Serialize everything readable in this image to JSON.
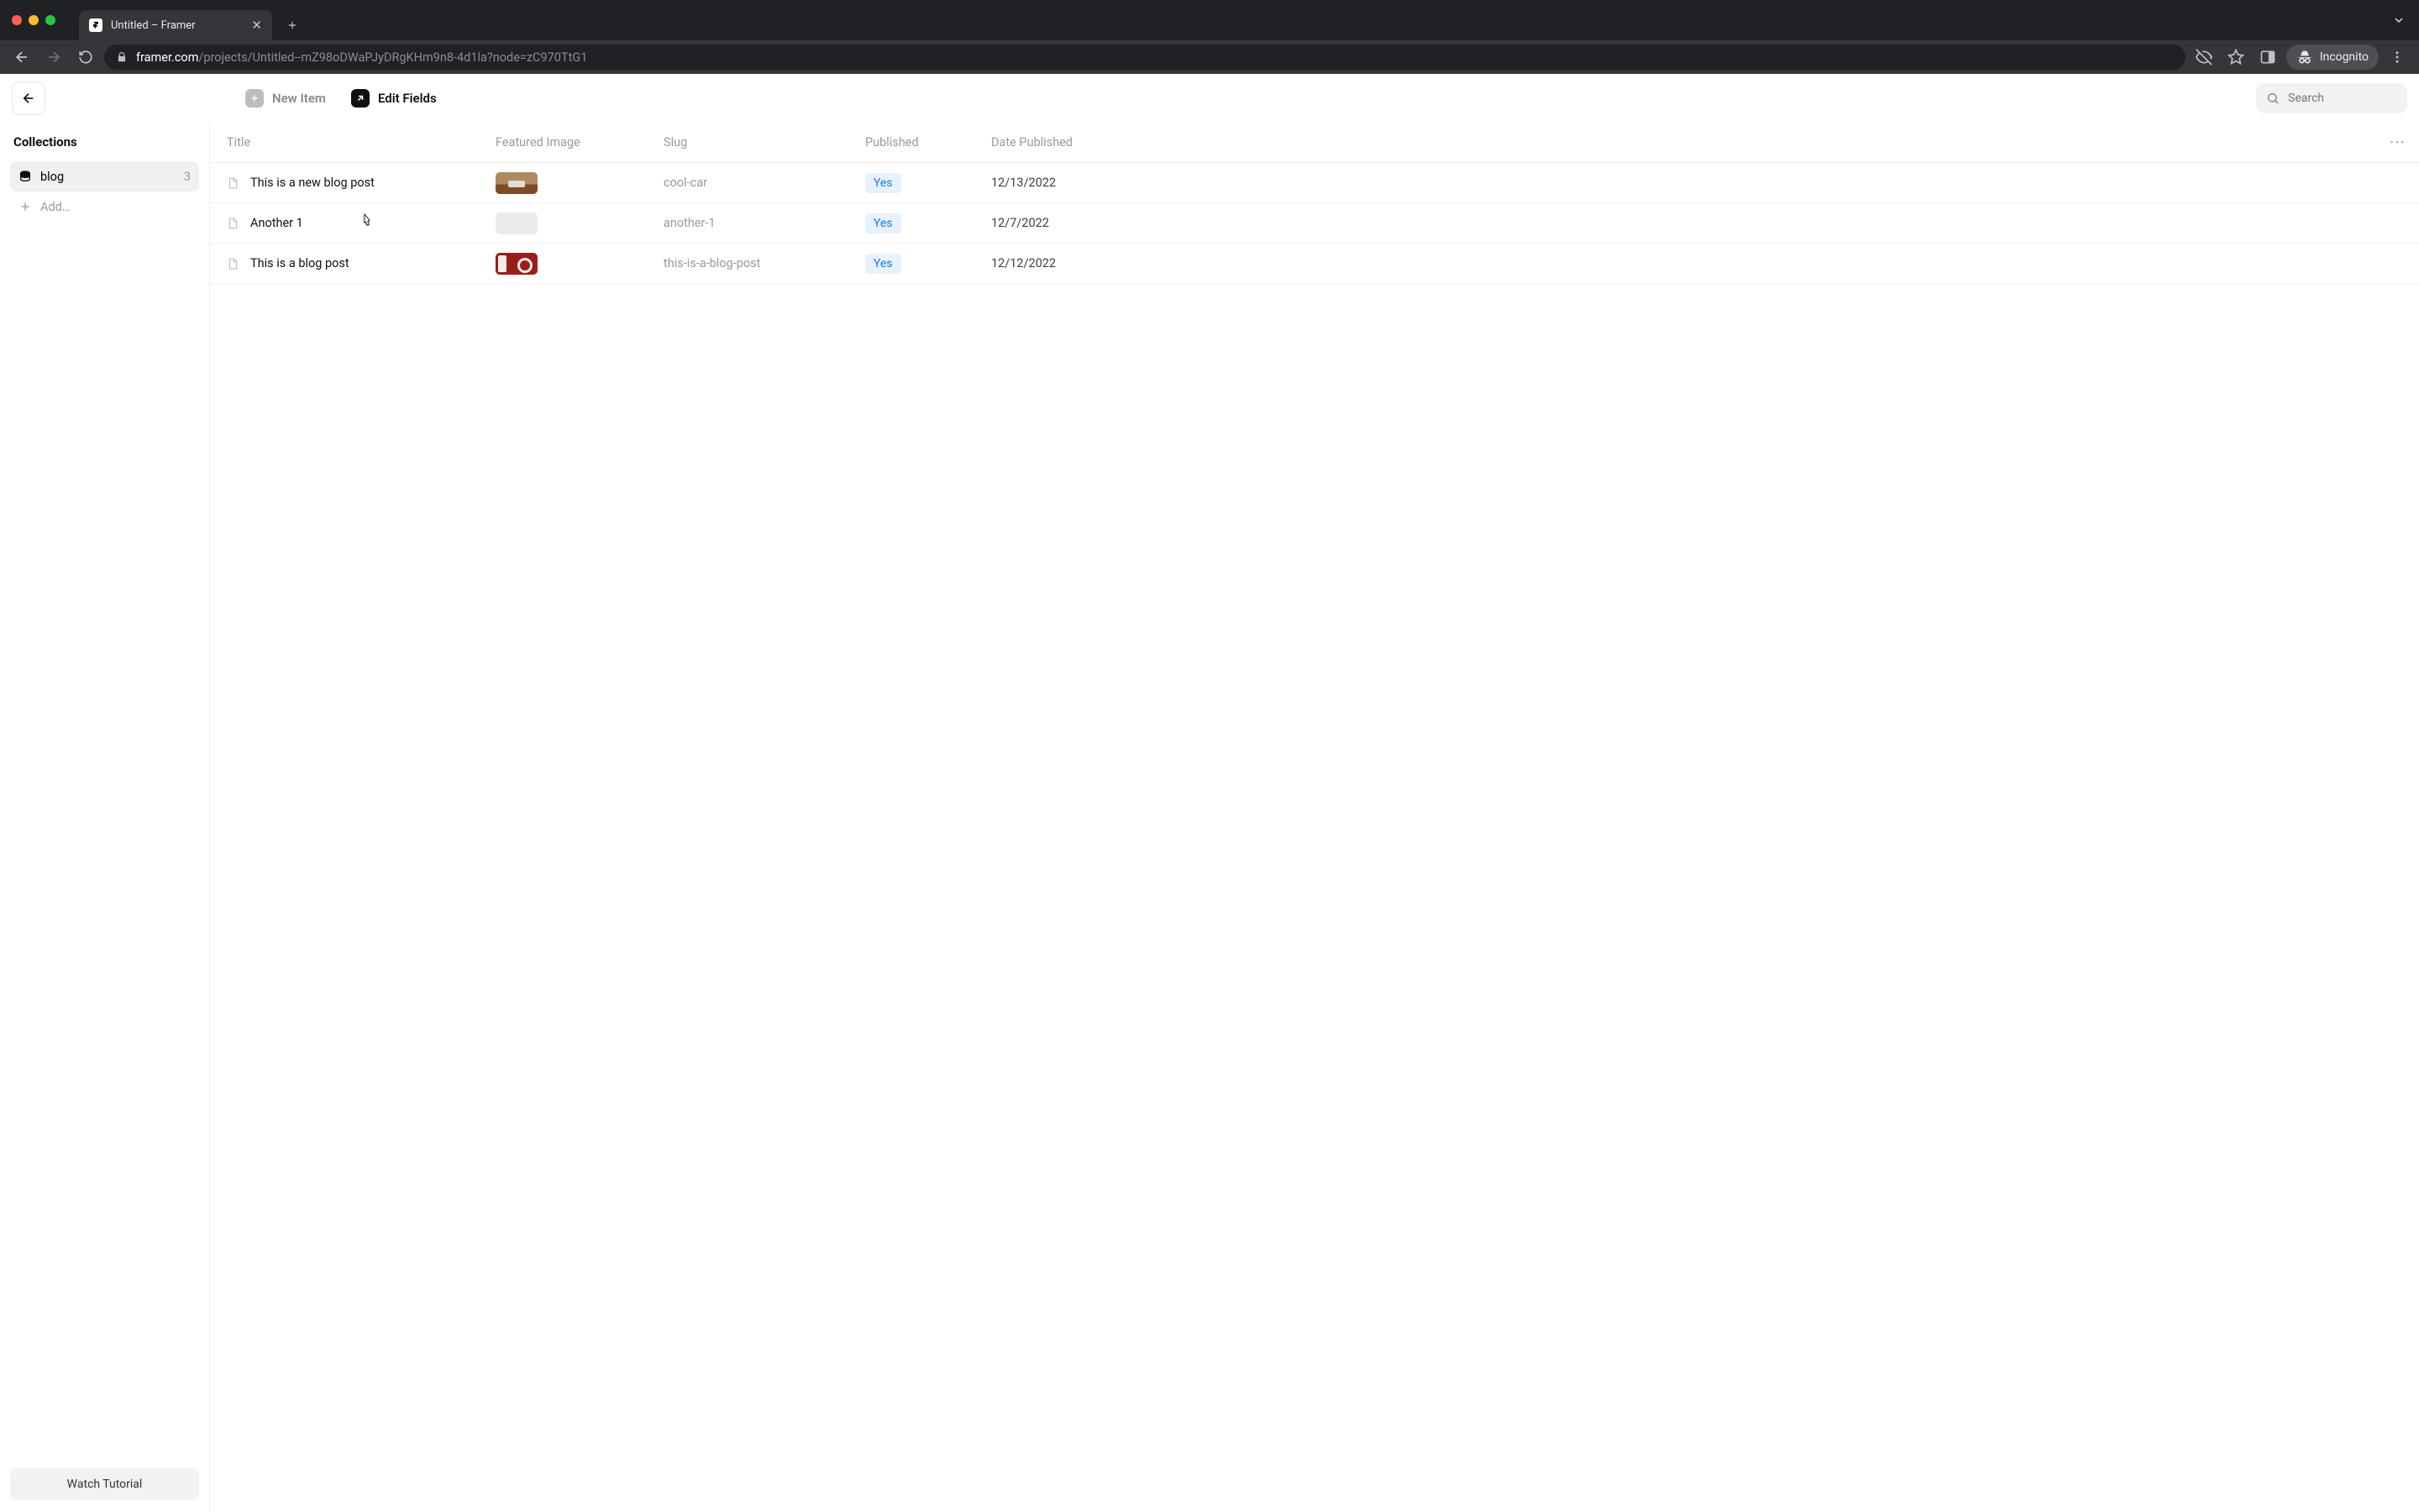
{
  "browser": {
    "tab_title": "Untitled – Framer",
    "url_domain": "framer.com",
    "url_path": "/projects/Untitled--mZ98oDWaPJyDRgKHm9n8-4d1la?node=zC970TtG1",
    "incognito_label": "Incognito"
  },
  "toolbar": {
    "new_item_label": "New Item",
    "edit_fields_label": "Edit Fields",
    "search_placeholder": "Search"
  },
  "sidebar": {
    "heading": "Collections",
    "items": [
      {
        "label": "blog",
        "count": "3"
      }
    ],
    "add_label": "Add…",
    "watch_tutorial_label": "Watch Tutorial"
  },
  "table": {
    "columns": [
      "Title",
      "Featured Image",
      "Slug",
      "Published",
      "Date Published"
    ],
    "rows": [
      {
        "title": "This is a new blog post",
        "thumb": "car",
        "slug": "cool-car",
        "published": "Yes",
        "date": "12/13/2022"
      },
      {
        "title": "Another 1",
        "thumb": "empty",
        "slug": "another-1",
        "published": "Yes",
        "date": "12/7/2022"
      },
      {
        "title": "This is a blog post",
        "thumb": "cup",
        "slug": "this-is-a-blog-post",
        "published": "Yes",
        "date": "12/12/2022"
      }
    ]
  }
}
